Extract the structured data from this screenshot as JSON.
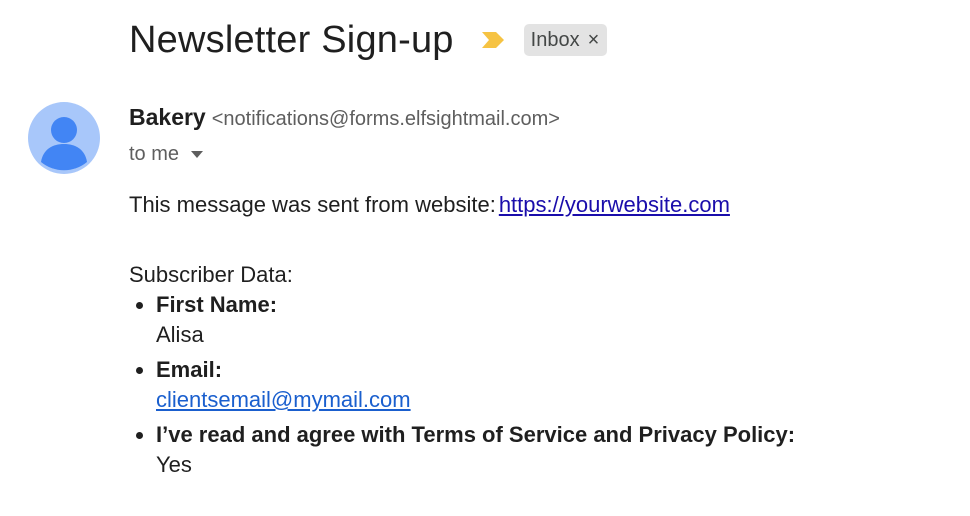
{
  "header": {
    "subject": "Newsletter Sign-up",
    "importance_icon": "importance-marker-icon",
    "importance_color": "#f6c343",
    "label": {
      "text": "Inbox",
      "remove_glyph": "×"
    }
  },
  "sender": {
    "avatar_icon": "default-avatar-icon",
    "avatar_bg": "#a8c7fa",
    "avatar_fg": "#4285f4",
    "name": "Bakery",
    "email": "<notifications@forms.elfsightmail.com>",
    "recipient": "to me"
  },
  "message": {
    "intro_text": "This message was sent from website:",
    "intro_link": "https://yourwebsite.com",
    "section_title": "Subscriber Data:",
    "fields": [
      {
        "label": "First Name:",
        "value": "Alisa"
      },
      {
        "label": "Email:",
        "value": "clientsemail@mymail.com"
      },
      {
        "label": "I’ve read and agree with Terms of Service and Privacy Policy:",
        "value": "Yes"
      }
    ]
  }
}
